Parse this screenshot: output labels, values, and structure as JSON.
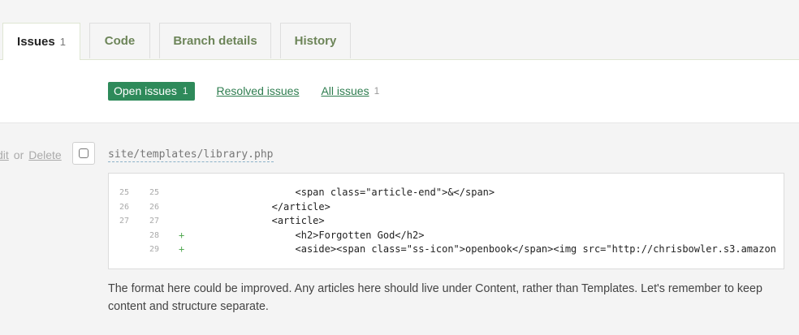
{
  "tabs": [
    {
      "label": "Issues",
      "count": "1"
    },
    {
      "label": "Code"
    },
    {
      "label": "Branch details"
    },
    {
      "label": "History"
    }
  ],
  "filters": {
    "open": {
      "label": "Open issues",
      "count": "1"
    },
    "resolved": {
      "label": "Resolved issues"
    },
    "all": {
      "label": "All issues",
      "count": "1"
    }
  },
  "issue": {
    "edit_label": "dit",
    "or_label": "or",
    "delete_label": "Delete",
    "file_path": "site/templates/library.php",
    "code_lines": [
      {
        "old": "25",
        "new": "25",
        "marker": "",
        "code": "                    <span class=\"article-end\">&</span>"
      },
      {
        "old": "26",
        "new": "26",
        "marker": "",
        "code": "                </article>"
      },
      {
        "old": "27",
        "new": "27",
        "marker": "",
        "code": "                <article>"
      },
      {
        "old": "",
        "new": "28",
        "marker": "+",
        "code": "                    <h2>Forgotten God</h2>"
      },
      {
        "old": "",
        "new": "29",
        "marker": "+",
        "code": "                    <aside><span class=\"ss-icon\">openbook</span><img src=\"http://chrisbowler.s3.amazon"
      }
    ],
    "comment": "The format here could be improved. Any articles here should live under Content, rather than Templates. Let's remember to keep content and structure separate."
  },
  "colors": {
    "accent_green": "#2e8a5a",
    "link_green": "#2e7d4f",
    "tab_text_green": "#6d8559",
    "added_line_bg": "#dbffdb"
  }
}
